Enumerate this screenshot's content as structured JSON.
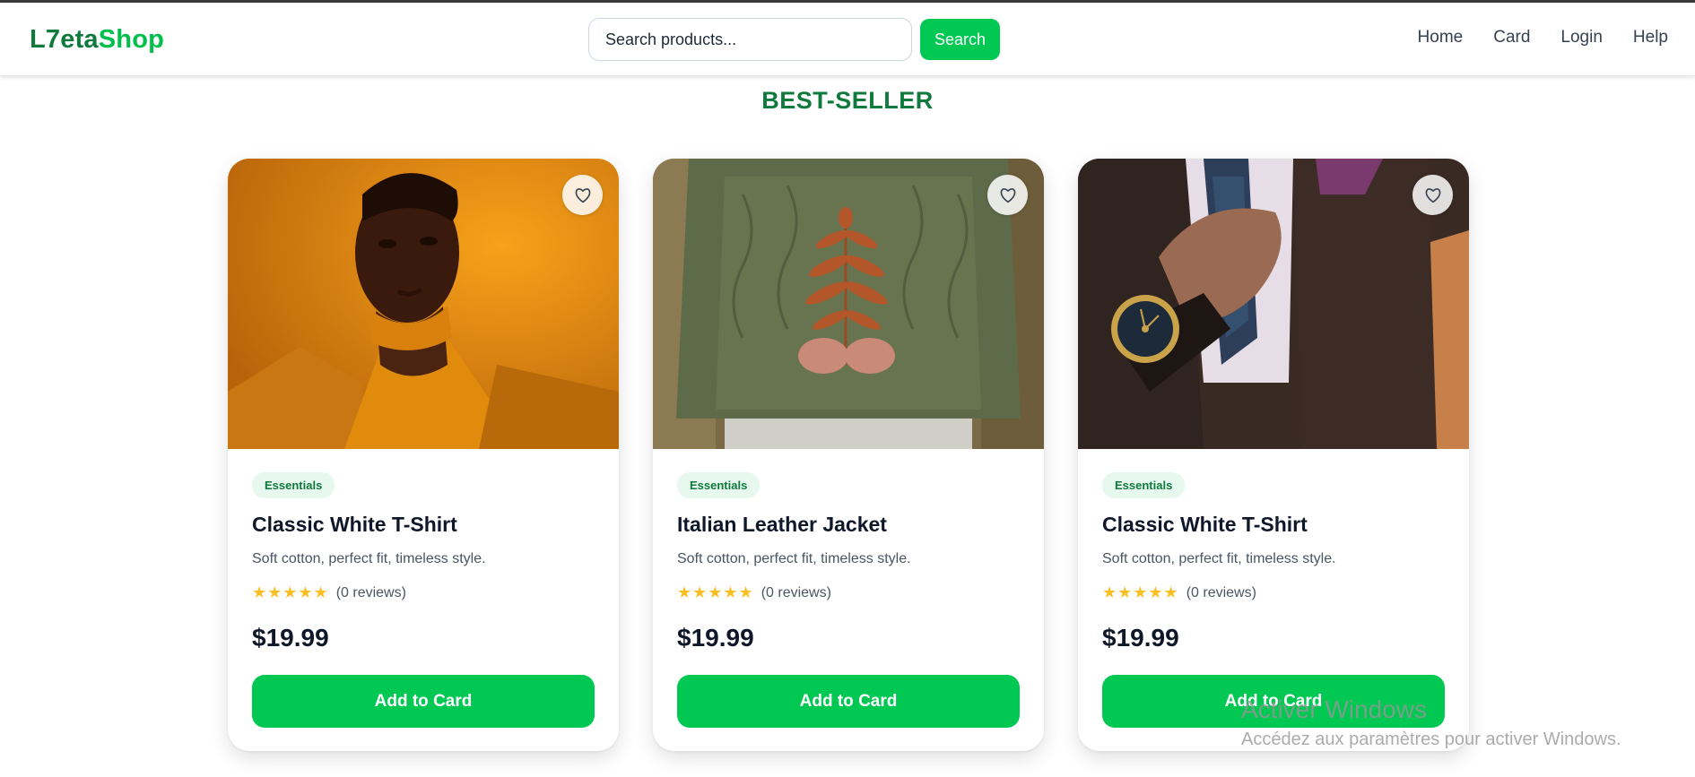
{
  "header": {
    "logo_part1": "L7eta",
    "logo_part2": "Shop",
    "search_placeholder": "Search products...",
    "search_button": "Search",
    "nav": [
      "Home",
      "Card",
      "Login",
      "Help"
    ]
  },
  "section": {
    "title": "BEST-SELLER"
  },
  "products": [
    {
      "badge": "Essentials",
      "title": "Classic White T-Shirt",
      "description": "Soft cotton, perfect fit, timeless style.",
      "stars": "★★★★★",
      "reviews": "(0 reviews)",
      "price": "$19.99",
      "button": "Add to Card",
      "image": "woman-orange-turtleneck-photo"
    },
    {
      "badge": "Essentials",
      "title": "Italian Leather Jacket",
      "description": "Soft cotton, perfect fit, timeless style.",
      "stars": "★★★★★",
      "reviews": "(0 reviews)",
      "price": "$19.99",
      "button": "Add to Card",
      "image": "green-sweater-fern-photo"
    },
    {
      "badge": "Essentials",
      "title": "Classic White T-Shirt",
      "description": "Soft cotton, perfect fit, timeless style.",
      "stars": "★★★★★",
      "reviews": "(0 reviews)",
      "price": "$19.99",
      "button": "Add to Card",
      "image": "suit-wristwatch-photo"
    }
  ],
  "watermark": {
    "title": "Activer Windows",
    "subtitle": "Accédez aux paramètres pour activer Windows."
  },
  "colors": {
    "brand_dark": "#0f7a3c",
    "brand_green": "#00c853",
    "star": "#fbbf24"
  }
}
